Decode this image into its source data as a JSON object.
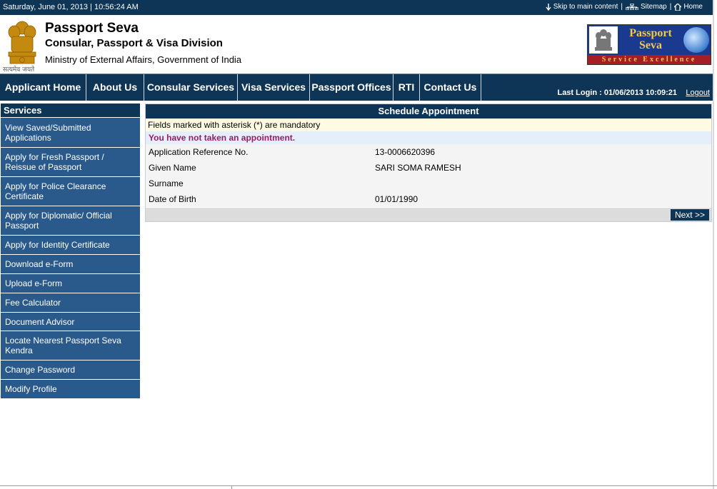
{
  "topbar": {
    "datetime": "Saturday,  June  01, 2013 | 10:56:24 AM",
    "skip_label": "Skip to main content",
    "sitemap_label": "Sitemap",
    "home_label": "Home",
    "separator": "|"
  },
  "header": {
    "title": "Passport Seva",
    "subtitle": "Consular, Passport & Visa Division",
    "ministry": "Ministry of External Affairs, Government of India",
    "emblem_caption": "सत्यमेव जयते",
    "logo": {
      "line1": "Passport",
      "line2": "Seva",
      "band": "Service Excellence"
    }
  },
  "nav": {
    "items": [
      {
        "label": "Applicant Home"
      },
      {
        "label": "About Us"
      },
      {
        "label": "Consular Services"
      },
      {
        "label": "Visa Services"
      },
      {
        "label": "Passport Offices"
      },
      {
        "label": "RTI"
      },
      {
        "label": "Contact Us"
      }
    ],
    "last_login": "Last Login : 01/06/2013 10:09:21",
    "logout_label": "Logout"
  },
  "sidebar": {
    "heading": "Services",
    "items": [
      {
        "label": "View Saved/Submitted Applications"
      },
      {
        "label": "Apply for Fresh Passport / Reissue of Passport"
      },
      {
        "label": "Apply for Police Clearance Certificate"
      },
      {
        "label": "Apply for Diplomatic/ Official Passport"
      },
      {
        "label": "Apply for Identity Certificate"
      },
      {
        "label": "Download e-Form"
      },
      {
        "label": "Upload e-Form"
      },
      {
        "label": "Fee Calculator"
      },
      {
        "label": "Document Advisor"
      },
      {
        "label": "Locate Nearest Passport Seva Kendra"
      },
      {
        "label": "Change Password"
      },
      {
        "label": "Modify Profile"
      }
    ]
  },
  "main": {
    "heading": "Schedule Appointment",
    "mandatory_note": "Fields marked with asterisk (*) are mandatory",
    "notice": "You have not taken an appointment.",
    "fields": [
      {
        "label": "Application Reference No.",
        "value": "13-0006620396"
      },
      {
        "label": "Given Name",
        "value": "SARI SOMA RAMESH"
      },
      {
        "label": "Surname",
        "value": ""
      },
      {
        "label": "Date of Birth",
        "value": "01/01/1990"
      }
    ],
    "next_label": "Next >>"
  },
  "colors": {
    "navy": "#0e3456",
    "sidebar_item": "#2a5a8c",
    "notice_text": "#9b1a66",
    "logo_blue": "#1a3a8f",
    "logo_red": "#a51d25",
    "logo_gold": "#f2c94c"
  }
}
